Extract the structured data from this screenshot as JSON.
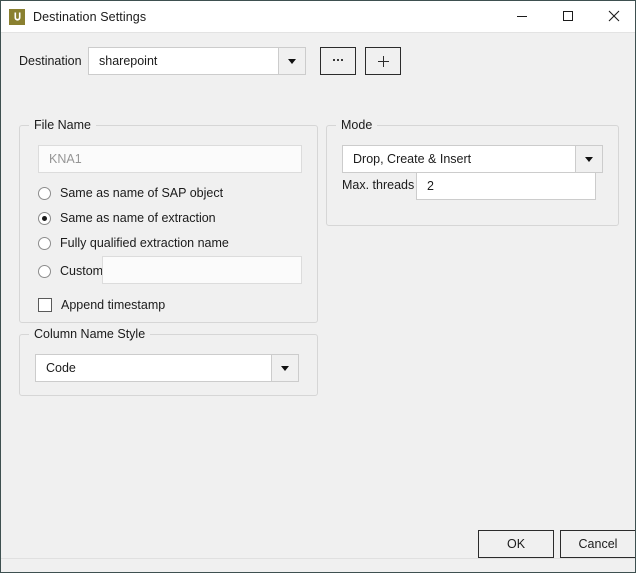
{
  "window": {
    "title": "Destination Settings",
    "icon": "app-logo-u-icon",
    "border_color": "#3e5050",
    "background_color": "#f0f0f0",
    "accent_color": "#8a8030",
    "controls": {
      "minimize": "minimize-icon",
      "maximize": "maximize-icon",
      "close": "close-icon"
    }
  },
  "destination": {
    "label": "Destination",
    "value": "sharepoint",
    "placeholder": "",
    "browse_label": "...",
    "add_label": "+"
  },
  "file_name": {
    "group_title": "File Name",
    "input_value": "KNA1",
    "input_enabled": "false",
    "options": [
      {
        "label": "Same as name of SAP object",
        "checked": "false"
      },
      {
        "label": "Same as name of extraction",
        "checked": "true"
      },
      {
        "label": "Fully qualified extraction name",
        "checked": "false"
      },
      {
        "label": "Custom",
        "checked": "false"
      }
    ],
    "custom_value": "",
    "append_timestamp": {
      "label": "Append timestamp",
      "checked": "false"
    }
  },
  "column_name_style": {
    "group_title": "Column Name Style",
    "value": "Code"
  },
  "mode": {
    "group_title": "Mode",
    "value": "Drop, Create & Insert",
    "threads_label": "Max. threads",
    "threads_value": "2"
  },
  "footer": {
    "ok_label": "OK",
    "cancel_label": "Cancel"
  }
}
